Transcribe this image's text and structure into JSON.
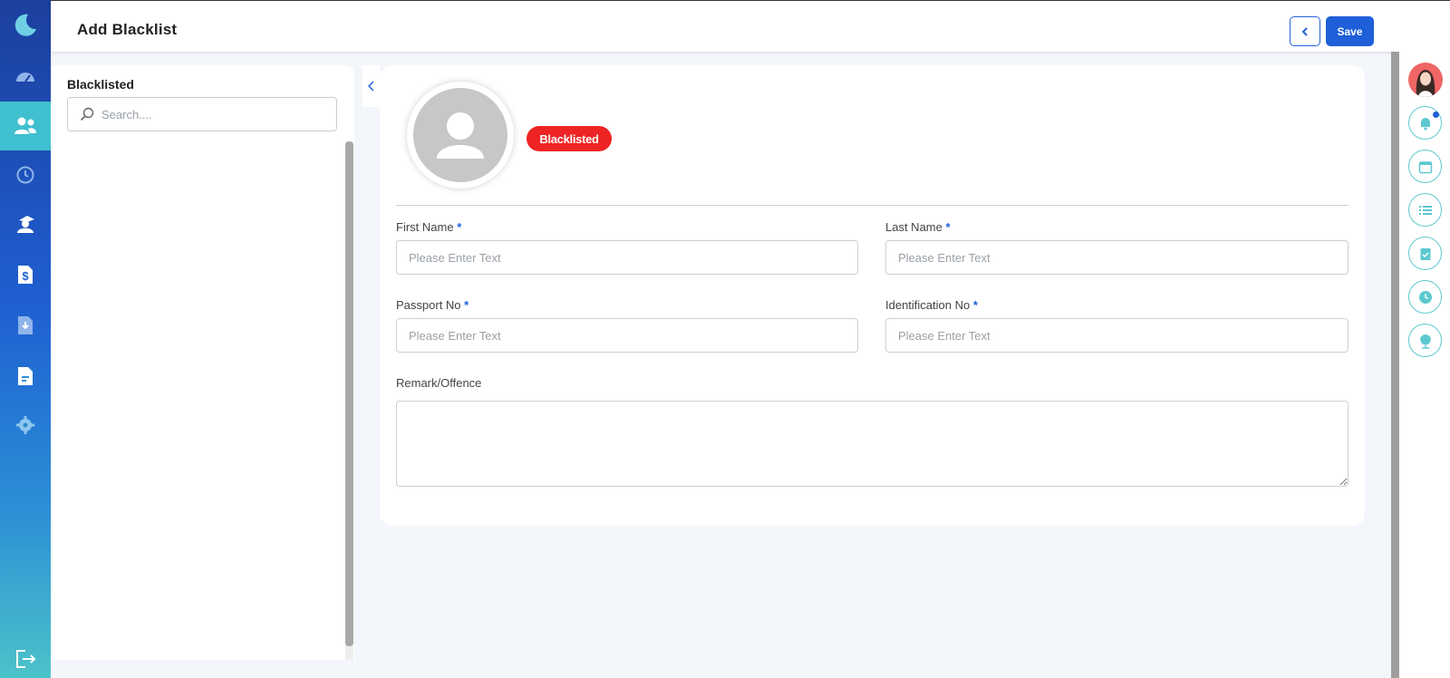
{
  "header": {
    "title": "Add Blacklist",
    "save_label": "Save"
  },
  "list_panel": {
    "title": "Blacklisted",
    "search_placeholder": "Search...."
  },
  "profile": {
    "status_badge": "Blacklisted"
  },
  "form": {
    "first_name": {
      "label": "First Name",
      "required_mark": "*",
      "placeholder": "Please Enter Text"
    },
    "last_name": {
      "label": "Last Name",
      "required_mark": "*",
      "placeholder": "Please Enter Text"
    },
    "passport_no": {
      "label": "Passport No",
      "required_mark": "*",
      "placeholder": "Please Enter Text"
    },
    "identification_no": {
      "label": "Identification No",
      "required_mark": "*",
      "placeholder": "Please Enter Text"
    },
    "remark": {
      "label": "Remark/Offence"
    }
  },
  "sidebar": {
    "items": [
      "dashboard-icon",
      "people-icon",
      "history-icon",
      "user-hat-icon",
      "dollar-doc-icon",
      "download-doc-icon",
      "report-doc-icon",
      "settings-icon",
      "logout-icon"
    ],
    "active_item": "people-icon"
  },
  "right_rail": {
    "items": [
      "user-avatar",
      "bell-icon",
      "calendar-icon",
      "list-icon",
      "clipboard-check-icon",
      "clock-icon",
      "globe-icon"
    ]
  },
  "colors": {
    "primary": "#1f5fd9",
    "accent_teal": "#3fbfcf",
    "danger": "#ee2424",
    "background": "#f3f6fa"
  }
}
